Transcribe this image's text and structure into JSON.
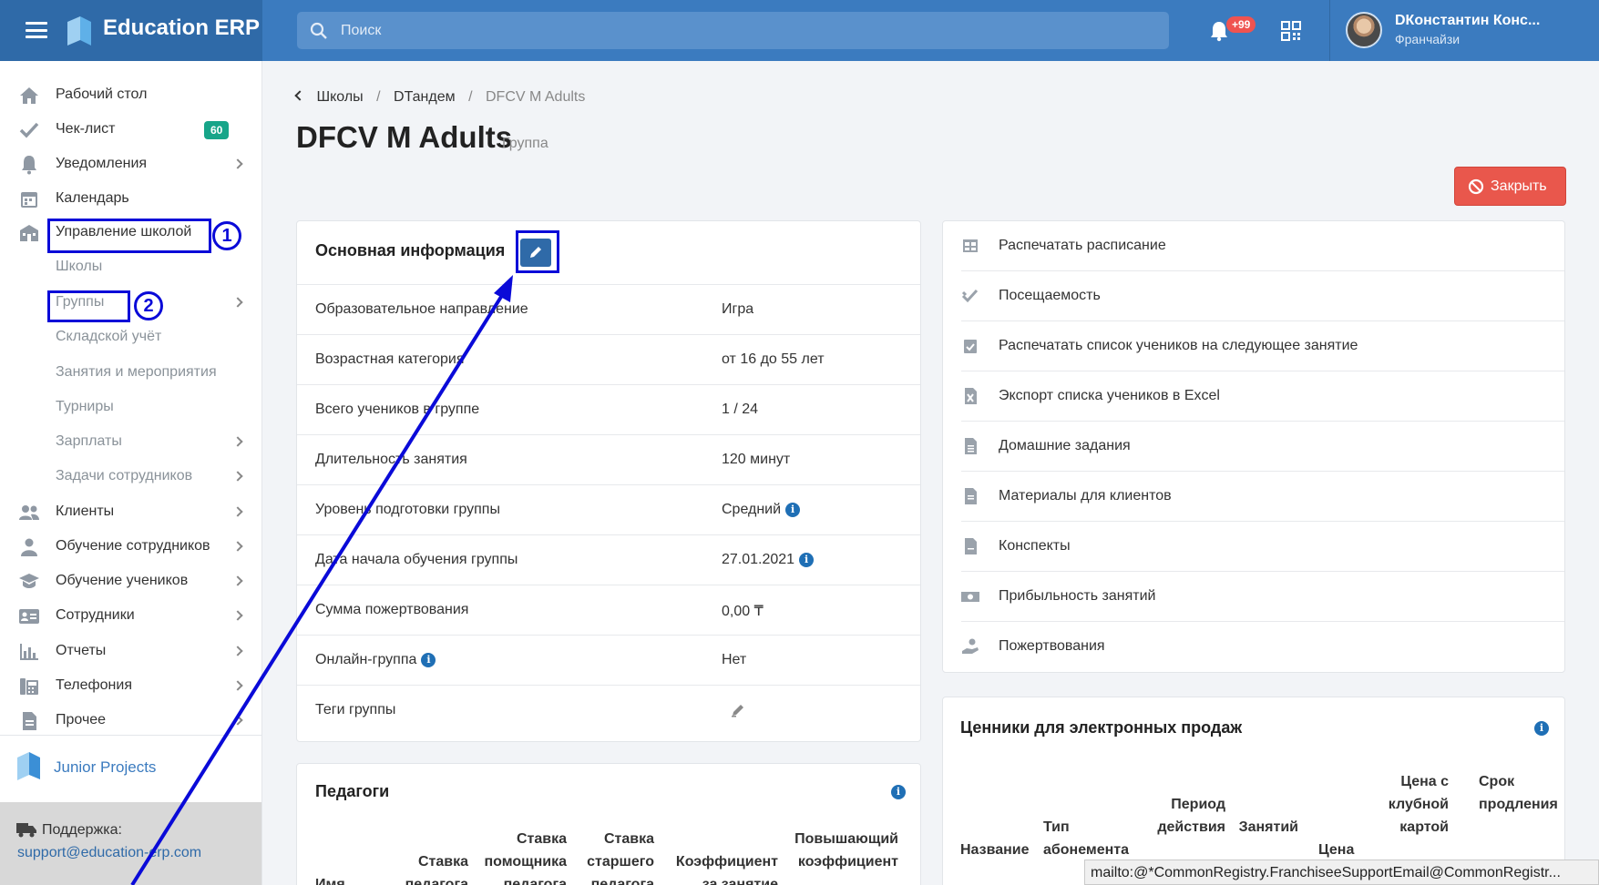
{
  "app": {
    "name": "Education ERP"
  },
  "search": {
    "placeholder": "Поиск"
  },
  "header": {
    "notifications_badge": "+99",
    "user_name": "DКонстантин Конс...",
    "user_role": "Франчайзи"
  },
  "sidebar": {
    "items": [
      {
        "label": "Рабочий стол",
        "icon": "home-icon"
      },
      {
        "label": "Чек-лист",
        "icon": "check-icon",
        "badge": "60"
      },
      {
        "label": "Уведомления",
        "icon": "bell-icon"
      },
      {
        "label": "Календарь",
        "icon": "calendar-icon"
      },
      {
        "label": "Управление школой",
        "icon": "school-icon"
      },
      {
        "label": "Школы"
      },
      {
        "label": "Группы"
      },
      {
        "label": "Складской учёт"
      },
      {
        "label": "Занятия и мероприятия"
      },
      {
        "label": "Турниры"
      },
      {
        "label": "Зарплаты"
      },
      {
        "label": "Задачи сотрудников"
      },
      {
        "label": "Клиенты",
        "icon": "users-icon"
      },
      {
        "label": "Обучение сотрудников",
        "icon": "person-icon"
      },
      {
        "label": "Обучение учеников",
        "icon": "graduation-cap-icon"
      },
      {
        "label": "Сотрудники",
        "icon": "id-card-icon"
      },
      {
        "label": "Отчеты",
        "icon": "chart-icon"
      },
      {
        "label": "Телефония",
        "icon": "phone-icon"
      },
      {
        "label": "Прочее",
        "icon": "file-icon"
      }
    ],
    "junior": "Junior Projects",
    "support_label": "Поддержка:",
    "support_email": "support@education-erp.com"
  },
  "annotations": {
    "one": "1",
    "two": "2"
  },
  "breadcrumb": [
    "Школы",
    "DТандем",
    "DFCV M Adults"
  ],
  "page": {
    "title": "DFCV M Adults",
    "subtitle": "Группа",
    "close_label": "Закрыть"
  },
  "info": {
    "title": "Основная информация",
    "rows": [
      {
        "label": "Образовательное направление",
        "value": "Игра"
      },
      {
        "label": "Возрастная категория",
        "value": "от 16 до 55 лет"
      },
      {
        "label": "Всего учеников в группе",
        "value": "1 / 24"
      },
      {
        "label": "Длительность занятия",
        "value": "120 минут"
      },
      {
        "label": "Уровень подготовки группы",
        "value": "Средний"
      },
      {
        "label": "Дата начала обучения группы",
        "value": "27.01.2021"
      },
      {
        "label": "Сумма пожертвования",
        "value": "0,00 ₸"
      },
      {
        "label": "Онлайн-группа",
        "value": "Нет"
      },
      {
        "label": "Теги группы",
        "value": ""
      }
    ]
  },
  "actions": [
    {
      "label": "Распечатать расписание",
      "icon": "table-icon"
    },
    {
      "label": "Посещаемость",
      "icon": "double-check-icon"
    },
    {
      "label": "Распечатать список учеников на следующее занятие",
      "icon": "calendar-check-icon"
    },
    {
      "label": "Экспорт списка учеников в Excel",
      "icon": "excel-icon"
    },
    {
      "label": "Домашние задания",
      "icon": "document-icon"
    },
    {
      "label": "Материалы для клиентов",
      "icon": "document-icon"
    },
    {
      "label": "Конспекты",
      "icon": "document-icon"
    },
    {
      "label": "Прибыльность занятий",
      "icon": "money-icon"
    },
    {
      "label": "Пожертвования",
      "icon": "hand-coin-icon"
    }
  ],
  "teachers": {
    "title": "Педагоги",
    "headers": [
      "Имя",
      "Ставка педагога",
      "Ставка помощника педагога",
      "Ставка старшего педагога",
      "Коэффициент за занятие",
      "Повышающий коэффициент"
    ]
  },
  "prices": {
    "title": "Ценники для электронных продаж",
    "headers": [
      "Название",
      "Тип абонемента",
      "Период действия",
      "Занятий",
      "Цена",
      "Цена с клубной картой",
      "Срок продления"
    ]
  },
  "status_url": "mailto:@*CommonRegistry.FranchiseeSupportEmail@CommonRegistr..."
}
